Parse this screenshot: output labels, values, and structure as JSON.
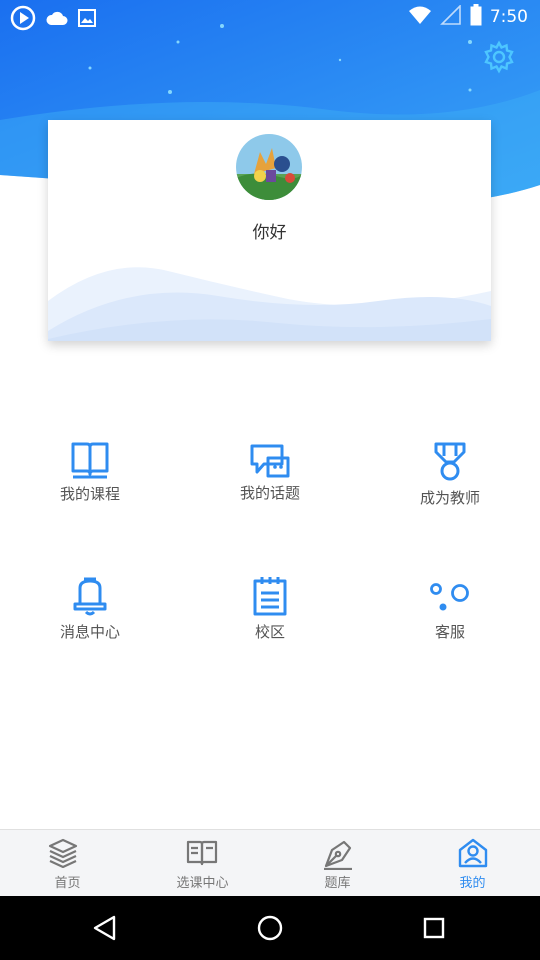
{
  "status_bar": {
    "time": "7:50",
    "left_icons": [
      "play-badge-icon",
      "cloud-icon",
      "image-icon"
    ],
    "right_icons": [
      "wifi-icon",
      "signal-icon",
      "battery-icon"
    ]
  },
  "header": {
    "settings_icon": "gear-icon",
    "gradient_colors": [
      "#1a73f0",
      "#3fa9f5"
    ]
  },
  "profile": {
    "greeting": "你好",
    "avatar_icon": "avatar"
  },
  "features": [
    {
      "label": "我的课程",
      "icon": "book-icon"
    },
    {
      "label": "我的话题",
      "icon": "chat-icon"
    },
    {
      "label": "成为教师",
      "icon": "medal-icon"
    },
    {
      "label": "消息中心",
      "icon": "bell-icon"
    },
    {
      "label": "校区",
      "icon": "notepad-icon"
    },
    {
      "label": "客服",
      "icon": "dots-icon"
    }
  ],
  "tabs": [
    {
      "label": "首页",
      "icon": "layers-icon",
      "active": false
    },
    {
      "label": "选课中心",
      "icon": "open-book-icon",
      "active": false
    },
    {
      "label": "题库",
      "icon": "pen-icon",
      "active": false
    },
    {
      "label": "我的",
      "icon": "user-house-icon",
      "active": true
    }
  ],
  "colors": {
    "accent": "#2f8cf0",
    "icon_blue": "#2f8cf0",
    "tab_inactive": "#777777"
  },
  "nav_bar": {
    "icons": [
      "back-icon",
      "home-icon",
      "recents-icon"
    ]
  }
}
